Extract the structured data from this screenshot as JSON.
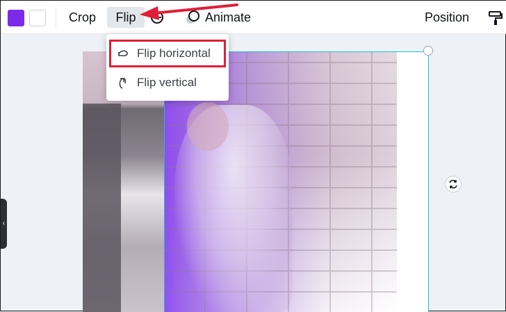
{
  "toolbar": {
    "colors": {
      "swatch_primary": "#7d2ae8",
      "swatch_secondary": "#ffffff"
    },
    "crop_label": "Crop",
    "flip_label": "Flip",
    "animate_label": "Animate",
    "position_label": "Position",
    "icons": [
      "rotate-icon",
      "animate-icon",
      "paint-roller-icon"
    ]
  },
  "flip_menu": {
    "items": [
      {
        "label": "Flip horizontal",
        "icon": "flip-horizontal-icon",
        "highlighted": true
      },
      {
        "label": "Flip vertical",
        "icon": "flip-vertical-icon",
        "highlighted": false
      }
    ]
  },
  "annotation": {
    "arrow_color": "#e01e37",
    "highlight_color": "#e01e37"
  },
  "canvas": {
    "selection_color": "#17c0d8",
    "side_tab_glyph": "‹"
  }
}
